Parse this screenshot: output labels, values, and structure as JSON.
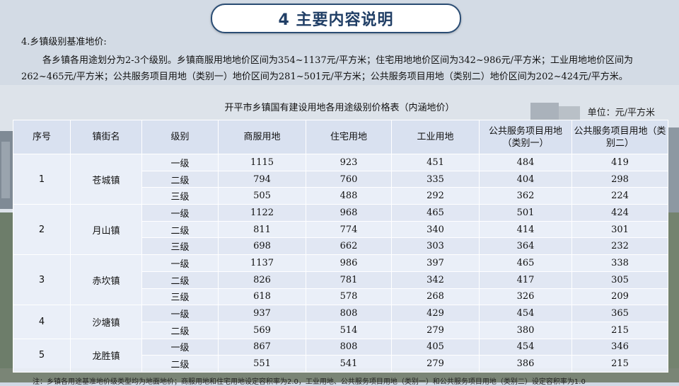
{
  "title": "4 主要内容说明",
  "section_heading": "4.乡镇级别基准地价:",
  "paragraph": "各乡镇各用途划分为2-3个级别。乡镇商服用地地价区间为354~1137元/平方米；住宅用地地价区间为342~986元/平方米；工业用地地价区间为262~465元/平方米；公共服务项目用地（类别一）地价区间为281~501元/平方米；公共服务项目用地（类别二）地价区间为202~424元/平方米。",
  "table_title": "开平市乡镇国有建设用地各用途级别价格表（内涵地价）",
  "unit": "单位：元/平方米",
  "headers": [
    "序号",
    "镇街名",
    "级别",
    "商服用地",
    "住宅用地",
    "工业用地",
    "公共服务项目用地（类别一）",
    "公共服务项目用地（类别二）"
  ],
  "towns": [
    {
      "no": "1",
      "name": "苍城镇",
      "levels": [
        {
          "level": "一级",
          "values": [
            "1115",
            "923",
            "451",
            "484",
            "419"
          ]
        },
        {
          "level": "二级",
          "values": [
            "794",
            "760",
            "335",
            "404",
            "298"
          ]
        },
        {
          "level": "三级",
          "values": [
            "505",
            "488",
            "292",
            "362",
            "224"
          ]
        }
      ]
    },
    {
      "no": "2",
      "name": "月山镇",
      "levels": [
        {
          "level": "一级",
          "values": [
            "1122",
            "968",
            "465",
            "501",
            "424"
          ]
        },
        {
          "level": "二级",
          "values": [
            "811",
            "774",
            "340",
            "414",
            "301"
          ]
        },
        {
          "level": "三级",
          "values": [
            "698",
            "662",
            "303",
            "364",
            "232"
          ]
        }
      ]
    },
    {
      "no": "3",
      "name": "赤坎镇",
      "levels": [
        {
          "level": "一级",
          "values": [
            "1137",
            "986",
            "397",
            "465",
            "338"
          ]
        },
        {
          "level": "二级",
          "values": [
            "826",
            "781",
            "342",
            "417",
            "305"
          ]
        },
        {
          "level": "三级",
          "values": [
            "618",
            "578",
            "268",
            "326",
            "209"
          ]
        }
      ]
    },
    {
      "no": "4",
      "name": "沙塘镇",
      "levels": [
        {
          "level": "一级",
          "values": [
            "937",
            "808",
            "429",
            "454",
            "365"
          ]
        },
        {
          "level": "二级",
          "values": [
            "569",
            "514",
            "279",
            "380",
            "215"
          ]
        }
      ]
    },
    {
      "no": "5",
      "name": "龙胜镇",
      "levels": [
        {
          "level": "一级",
          "values": [
            "867",
            "808",
            "405",
            "454",
            "346"
          ]
        },
        {
          "level": "二级",
          "values": [
            "551",
            "541",
            "279",
            "386",
            "215"
          ]
        }
      ]
    }
  ],
  "footnote": "注：乡镇各用途基准地价级类型均为地面地价；商服用地和住宅用地设定容积率为2.0，工业用地、公共服务项目用地（类别一）和公共服务项目用地（类别二）设定容积率为1.0"
}
